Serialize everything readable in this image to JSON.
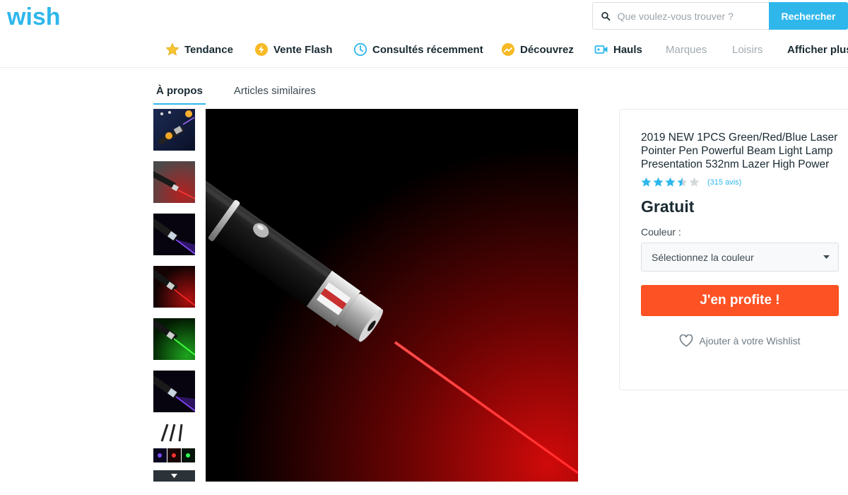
{
  "header": {
    "logo_text": "wish",
    "search_placeholder": "Que voulez-vous trouver ?",
    "search_button": "Rechercher"
  },
  "nav": {
    "items": [
      {
        "label": "Tendance",
        "icon": "star-icon"
      },
      {
        "label": "Vente Flash",
        "icon": "flash-icon"
      },
      {
        "label": "Consultés récemment",
        "icon": "clock-icon"
      },
      {
        "label": "Découvrez",
        "icon": "trend-icon"
      },
      {
        "label": "Hauls",
        "icon": "video-icon"
      },
      {
        "label": "Marques",
        "icon": ""
      },
      {
        "label": "Loisirs",
        "icon": ""
      },
      {
        "label": "Afficher plus",
        "icon": ""
      }
    ]
  },
  "tabs": [
    {
      "label": "À propos",
      "active": true
    },
    {
      "label": "Articles similaires",
      "active": false
    }
  ],
  "product": {
    "title": "2019 NEW 1PCS Green/Red/Blue Laser Pointer Pen Powerful Beam Light Lamp Presentation 532nm Lazer High Power",
    "rating": 3.5,
    "reviews": "(315 avis)",
    "price": "Gratuit",
    "color_label": "Couleur :",
    "color_select": "Sélectionnez la couleur",
    "buy_button": "J'en profite !",
    "wishlist": "Ajouter à votre Wishlist"
  },
  "colors": {
    "brand_blue": "#2fb7ec",
    "buy_orange": "#fd5223",
    "star_blue": "#2fb7ec"
  }
}
